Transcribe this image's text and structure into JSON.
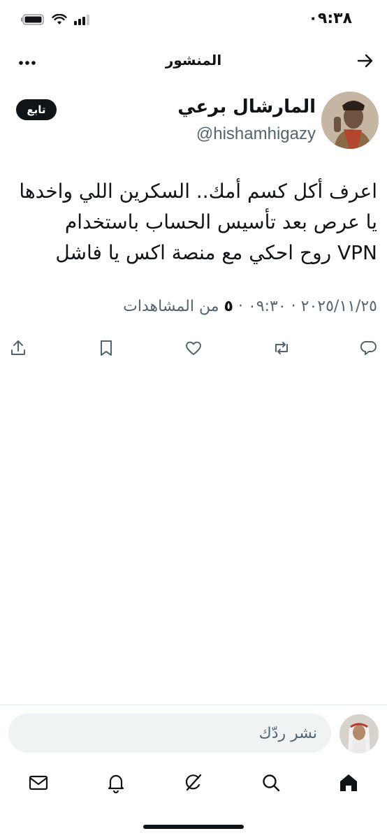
{
  "status": {
    "time": "٠٩:٣٨"
  },
  "header": {
    "title": "المنشور"
  },
  "author": {
    "name": "المارشال برعي",
    "handle": "@hishamhigazy",
    "follow_label": "تابع"
  },
  "tweet": {
    "lines": [
      "اعرف أكل كسم أمك.. السكرين اللي واخدها",
      "يا عرص بعد تأسيس الحساب باستخدام",
      "VPN  روح احكي مع منصة اكس يا فاشل"
    ],
    "date": "٢٠٢٥/١١/٢٥",
    "time": "٠٩:٣٠",
    "separator": "·",
    "views_count": "٥",
    "views_label": "من المشاهدات"
  },
  "reply": {
    "placeholder": "نشر ردّك"
  },
  "icons": {
    "back": "arrow-right-icon",
    "more": "more-icon",
    "reply": "reply-icon",
    "repost": "repost-icon",
    "like": "heart-icon",
    "bookmark": "bookmark-icon",
    "share": "share-icon",
    "home": "home-icon",
    "search": "search-icon",
    "grok": "grok-icon",
    "notifications": "bell-icon",
    "messages": "mail-icon"
  }
}
